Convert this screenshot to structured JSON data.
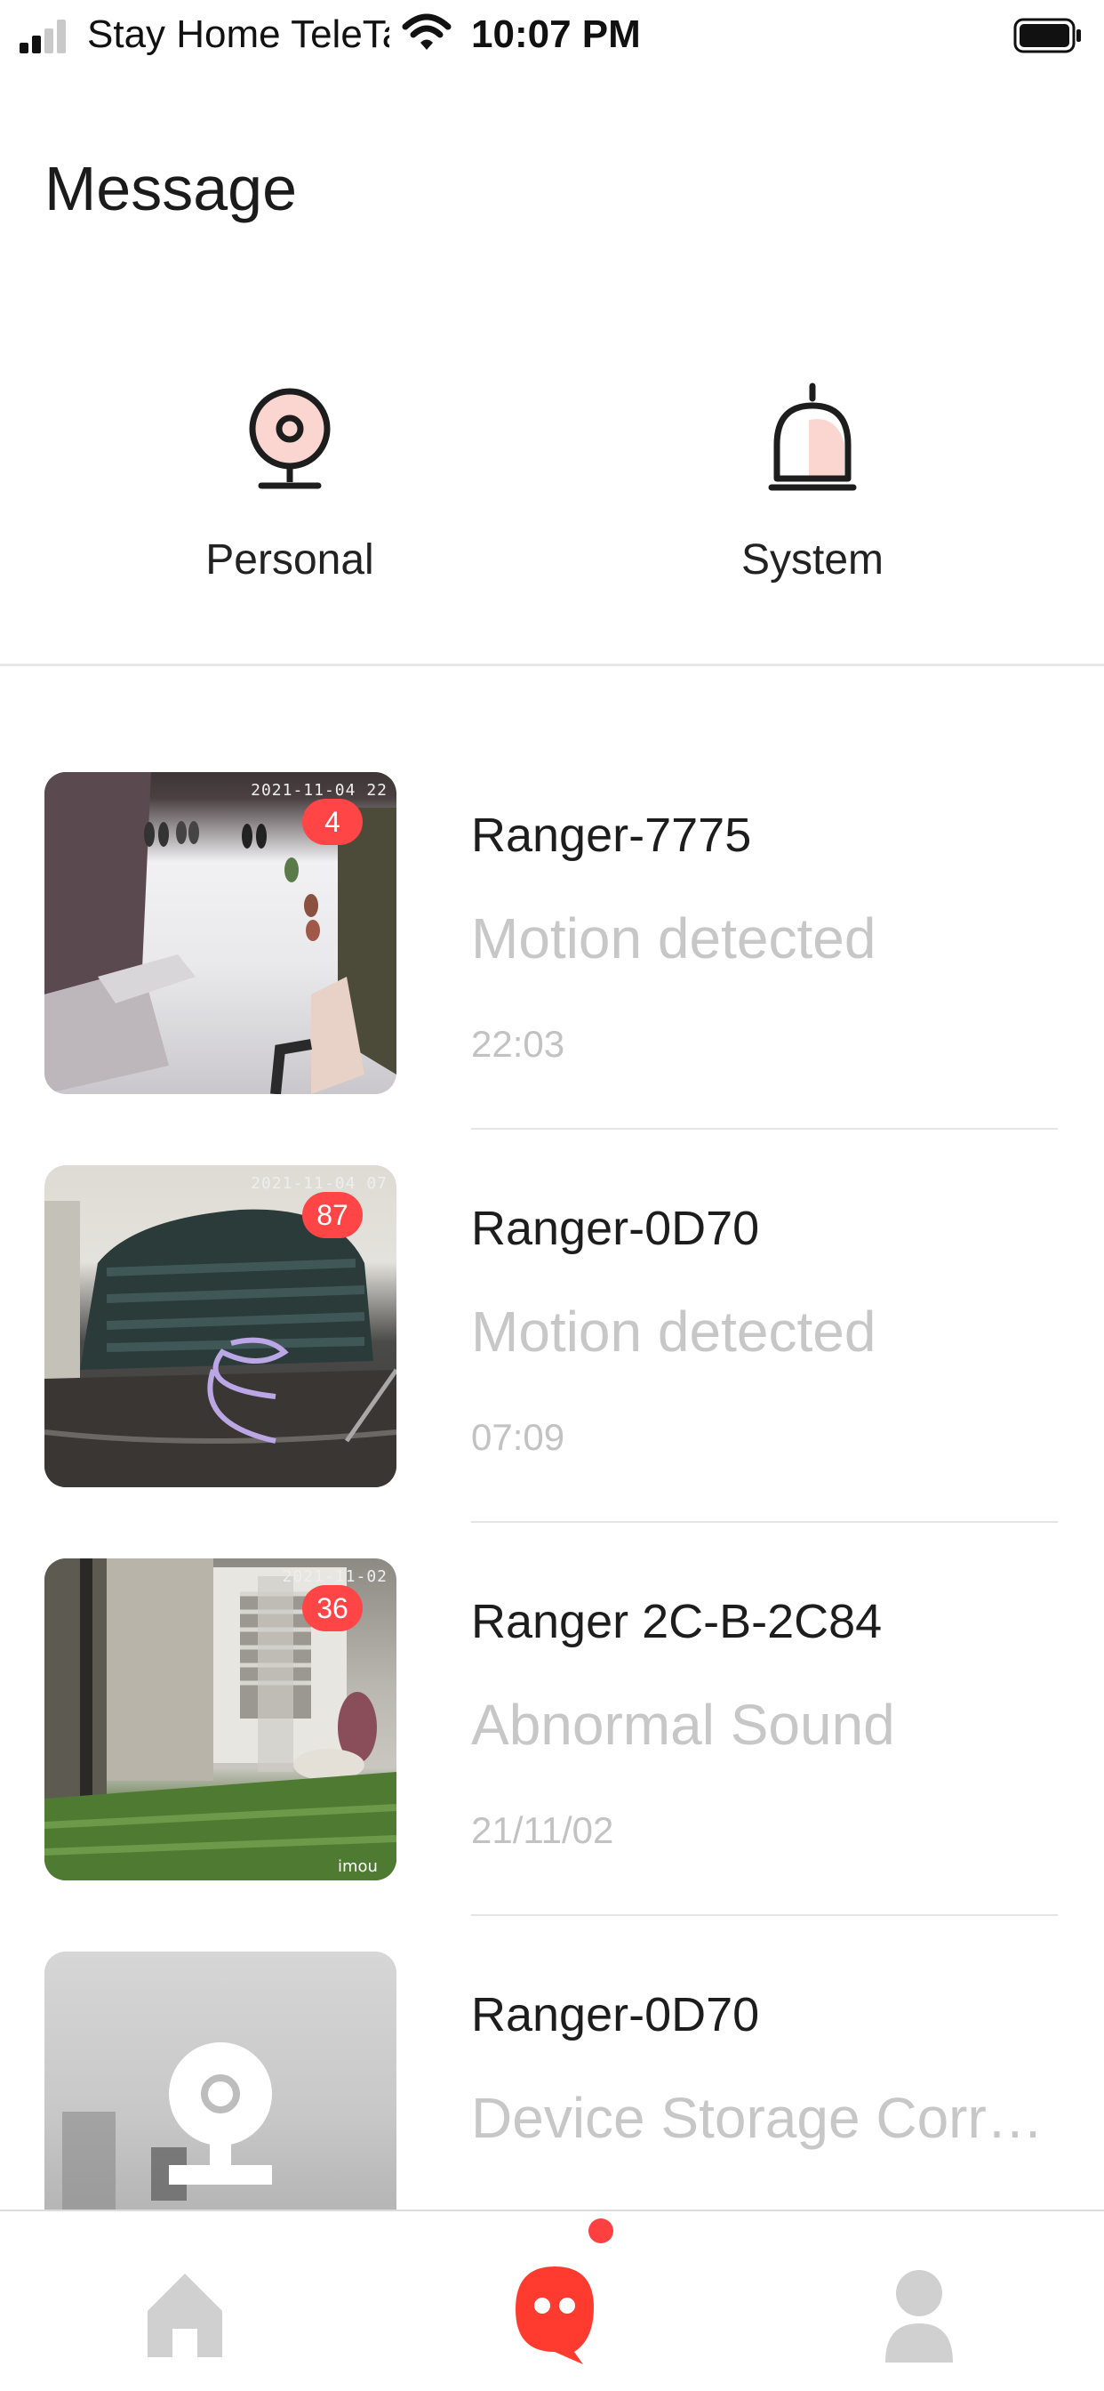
{
  "status_bar": {
    "carrier": "Stay Home TeleTal",
    "time": "10:07 PM"
  },
  "page": {
    "title": "Message"
  },
  "categories": [
    {
      "label": "Personal",
      "icon": "camera-icon"
    },
    {
      "label": "System",
      "icon": "bell-icon"
    }
  ],
  "messages": [
    {
      "device": "Ranger-7775",
      "event": "Motion detected",
      "time": "22:03",
      "badge": "4",
      "stamp": "2021-11-04 22"
    },
    {
      "device": "Ranger-0D70",
      "event": "Motion detected",
      "time": "07:09",
      "badge": "87",
      "stamp": "2021-11-04 07"
    },
    {
      "device": "Ranger 2C-B-2C84",
      "event": "Abnormal Sound",
      "time": "21/11/02",
      "badge": "36",
      "stamp": "2021-11-02",
      "watermark": "imou"
    },
    {
      "device": "Ranger-0D70",
      "event": "Device Storage Corrup...",
      "time": "",
      "badge": ""
    }
  ],
  "tabbar": {
    "items": [
      {
        "name": "home",
        "icon": "home-icon",
        "active": false
      },
      {
        "name": "message",
        "icon": "message-icon",
        "active": true,
        "dot": true
      },
      {
        "name": "profile",
        "icon": "profile-icon",
        "active": false
      }
    ]
  },
  "colors": {
    "accent": "#ff3b2f",
    "badge": "#ff4545",
    "muted_text": "#c7c7c7",
    "icon_gray": "#d0d0d0"
  }
}
